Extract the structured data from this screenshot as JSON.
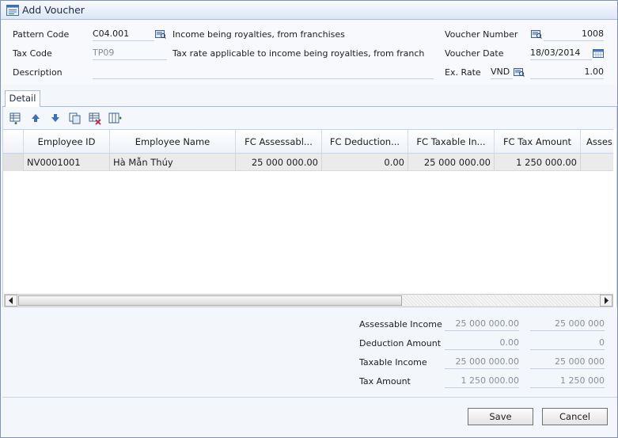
{
  "window": {
    "title": "Add Voucher"
  },
  "header": {
    "pattern_code_label": "Pattern Code",
    "pattern_code_value": "C04.001",
    "pattern_code_desc": "Income being royalties, from franchises",
    "tax_code_label": "Tax Code",
    "tax_code_value": "TP09",
    "tax_code_desc": "Tax rate applicable to income being royalties, from franch",
    "description_label": "Description",
    "description_value": "",
    "voucher_number_label": "Voucher Number",
    "voucher_number_value": "1008",
    "voucher_date_label": "Voucher Date",
    "voucher_date_value": "18/03/2014",
    "ex_rate_label": "Ex. Rate",
    "currency_value": "VND",
    "ex_rate_value": "1.00"
  },
  "tabs": {
    "detail": "Detail"
  },
  "toolbar": {
    "icons": [
      "add-row-icon",
      "move-up-icon",
      "move-down-icon",
      "copy-row-icon",
      "delete-row-icon",
      "columns-icon"
    ]
  },
  "grid": {
    "columns": [
      "Employee ID",
      "Employee Name",
      "FC Assessabl...",
      "FC Deduction...",
      "FC Taxable In...",
      "FC Tax Amount",
      "Asses"
    ],
    "rows": [
      [
        "NV0001001",
        "Hà Mẫn Thúy",
        "25 000 000.00",
        "0.00",
        "25 000 000.00",
        "1 250 000.00",
        ""
      ]
    ]
  },
  "totals": {
    "assessable_income_label": "Assessable Income",
    "assessable_income_fc": "25 000 000.00",
    "assessable_income": "25 000 000",
    "deduction_amount_label": "Deduction Amount",
    "deduction_amount_fc": "0.00",
    "deduction_amount": "0",
    "taxable_income_label": "Taxable Income",
    "taxable_income_fc": "25 000 000.00",
    "taxable_income": "25 000 000",
    "tax_amount_label": "Tax Amount",
    "tax_amount_fc": "1 250 000.00",
    "tax_amount": "1 250 000"
  },
  "footer": {
    "save_label": "Save",
    "cancel_label": "Cancel"
  },
  "colors": {
    "accent": "#a9bcd9",
    "row_selected": "#ebebeb"
  }
}
